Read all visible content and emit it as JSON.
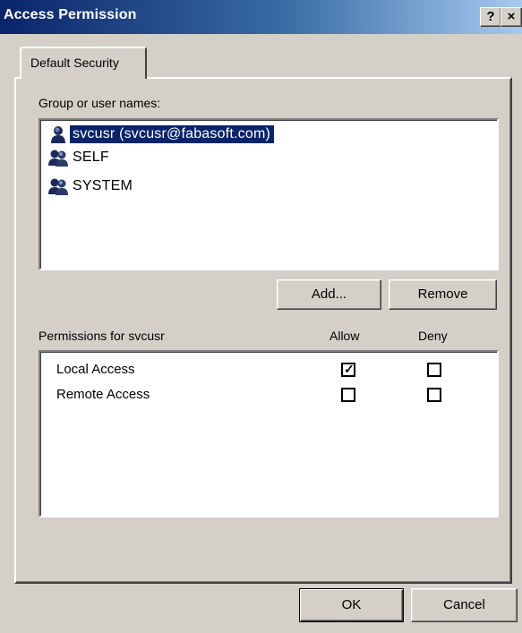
{
  "window": {
    "title": "Access Permission",
    "help_label": "?",
    "close_label": "×"
  },
  "tabs": [
    {
      "label": "Default Security",
      "selected": true
    }
  ],
  "users": {
    "label": "Group or user names:",
    "items": [
      {
        "name": "svcusr (svcusr@fabasoft.com)",
        "icon": "user-icon",
        "selected": true
      },
      {
        "name": "SELF",
        "icon": "group-icon",
        "selected": false
      },
      {
        "name": "SYSTEM",
        "icon": "group-icon",
        "selected": false
      }
    ],
    "add_label": "Add...",
    "remove_label": "Remove"
  },
  "permissions": {
    "label": "Permissions for svcusr",
    "allow_header": "Allow",
    "deny_header": "Deny",
    "rows": [
      {
        "name": "Local Access",
        "allow": true,
        "deny": false
      },
      {
        "name": "Remote Access",
        "allow": false,
        "deny": false
      }
    ]
  },
  "footer": {
    "ok_label": "OK",
    "cancel_label": "Cancel"
  },
  "colors": {
    "title_bar": "#0a246a",
    "selection": "#0a246a",
    "face": "#d4d0c8"
  }
}
